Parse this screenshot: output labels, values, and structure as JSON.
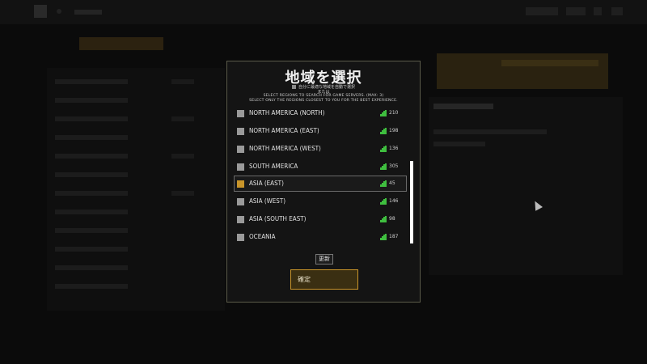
{
  "modal": {
    "title": "地域を選択",
    "auto_select_label": "自分に最適な地域を自動で選択",
    "or_text": "または",
    "instruction_1": "SELECT REGIONS TO SEARCH FOR GAME SERVERS. (MAX: 3)",
    "instruction_2": "SELECT ONLY THE REGIONS CLOSEST TO YOU FOR THE BEST EXPERIENCE.",
    "refresh_label": "更新",
    "confirm_label": "確定"
  },
  "regions": [
    {
      "name": "NORTH AMERICA (NORTH)",
      "ping": "210",
      "selected": false
    },
    {
      "name": "NORTH AMERICA (EAST)",
      "ping": "198",
      "selected": false
    },
    {
      "name": "NORTH AMERICA (WEST)",
      "ping": "136",
      "selected": false
    },
    {
      "name": "SOUTH AMERICA",
      "ping": "305",
      "selected": false
    },
    {
      "name": "ASIA (EAST)",
      "ping": "45",
      "selected": true
    },
    {
      "name": "ASIA (WEST)",
      "ping": "146",
      "selected": false
    },
    {
      "name": "ASIA (SOUTH EAST)",
      "ping": "98",
      "selected": false
    },
    {
      "name": "OCEANIA",
      "ping": "187",
      "selected": false
    }
  ],
  "colors": {
    "accent": "#c9952a",
    "signal": "#3fbf3f",
    "panel_border": "#5b5b4a"
  }
}
